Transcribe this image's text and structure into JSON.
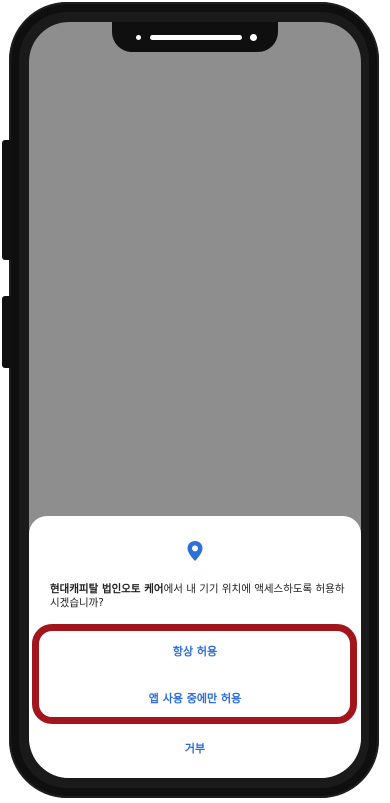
{
  "colors": {
    "frame": "#0f0f0f",
    "screen_dim": "#8e8e8e",
    "dialog_bg": "#ffffff",
    "accent_blue": "#2e6fd8",
    "highlight_red": "#a3151c"
  },
  "dialog": {
    "icon": "location-pin-icon",
    "app_name": "현대캐피탈 법인오토 케어",
    "message_rest": "에서 내 기기 위치에 액세스하도록 허용하시겠습니까?",
    "options": {
      "always": "항상 허용",
      "while_using": "앱 사용 중에만 허용",
      "deny": "거부"
    }
  }
}
